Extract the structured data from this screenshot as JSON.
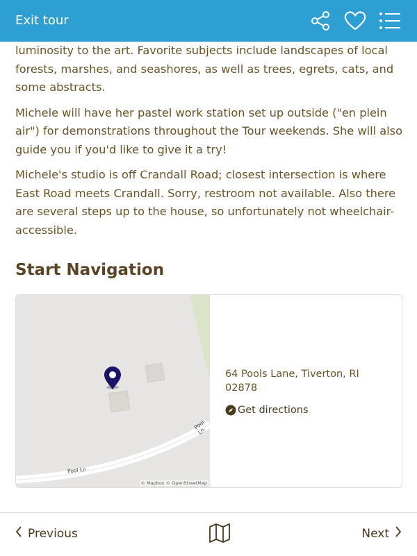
{
  "header": {
    "exit_label": "Exit tour",
    "background": "#2e9fd3"
  },
  "content": {
    "paragraphs": [
      "luminosity to the art. Favorite subjects include landscapes of local forests, marshes, and seashores, as well as trees, egrets, cats, and some abstracts.",
      "Michele will have her pastel work station set up outside (\"en plein air\") for demonstrations throughout the Tour weekends. She will also guide you if you'd like to give it a try!",
      "Michele's studio is off Crandall Road; closest intersection is where East Road meets Crandall. Sorry, restroom not available. Also there are several steps up to the house, so unfortunately not wheelchair-accessible."
    ],
    "nav_title": "Start Navigation"
  },
  "map": {
    "road_label_1": "Pool Ln",
    "road_label_2": "Pool Ln",
    "attribution": "© Mapbox © OpenStreetMap"
  },
  "location": {
    "address": "64 Pools Lane, Tiverton, RI 02878",
    "directions_label": "Get directions"
  },
  "footer": {
    "previous_label": "Previous",
    "next_label": "Next"
  }
}
